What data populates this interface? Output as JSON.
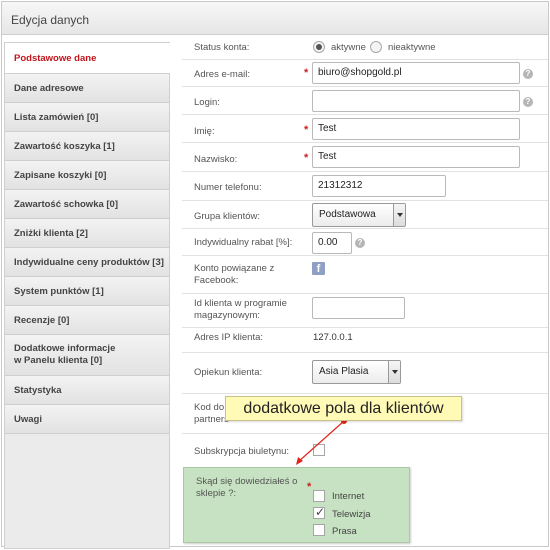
{
  "header": {
    "title": "Edycja danych"
  },
  "sidebar": {
    "items": [
      {
        "label": "Podstawowe dane",
        "active": true
      },
      {
        "label": "Dane adresowe"
      },
      {
        "label": "Lista zamówień [0]"
      },
      {
        "label": "Zawartość koszyka [1]"
      },
      {
        "label": "Zapisane koszyki [0]"
      },
      {
        "label": "Zawartość schowka [0]"
      },
      {
        "label": "Zniżki klienta [2]"
      },
      {
        "label": "Indywidualne ceny produktów [3]"
      },
      {
        "label": "System punktów [1]"
      },
      {
        "label": "Recenzje [0]"
      },
      {
        "label_line1": "Dodatkowe informacje",
        "label_line2": "w Panelu klienta [0]"
      },
      {
        "label": "Statystyka"
      },
      {
        "label": "Uwagi"
      }
    ]
  },
  "form": {
    "status": {
      "label": "Status konta:",
      "opt_active": "aktywne",
      "opt_inactive": "nieaktywne",
      "selected": "aktywne"
    },
    "email": {
      "label": "Adres e-mail:",
      "value": "biuro@shopgold.pl",
      "required_mark": "*",
      "help": "?"
    },
    "login": {
      "label": "Login:",
      "value": "",
      "help": "?"
    },
    "first_name": {
      "label": "Imię:",
      "value": "Test",
      "required_mark": "*"
    },
    "last_name": {
      "label": "Nazwisko:",
      "value": "Test",
      "required_mark": "*"
    },
    "phone": {
      "label": "Numer telefonu:",
      "value": "21312312"
    },
    "group": {
      "label": "Grupa klientów:",
      "value": "Podstawowa"
    },
    "discount": {
      "label": "Indywidualny rabat [%]:",
      "value": "0.00",
      "help": "?"
    },
    "facebook": {
      "label_line1": "Konto powiązane z",
      "label_line2": "Facebook:",
      "icon": "f"
    },
    "loyalty_id": {
      "label_line1": "Id klienta w programie",
      "label_line2": "magazynowym:",
      "value": ""
    },
    "ip": {
      "label": "Adres IP klienta:",
      "value": "127.0.0.1"
    },
    "caretaker": {
      "label": "Opiekun klienta:",
      "value": "Asia Plasia"
    },
    "partner_code": {
      "label_line1": "Kod do p",
      "label_line2": "partners"
    },
    "newsletter": {
      "label": "Subskrypcja biuletynu:",
      "checked": false
    },
    "source": {
      "label_line1": "Skąd się dowiedziałeś o",
      "label_line2": "sklepie ?:",
      "required_mark": "*",
      "options": [
        {
          "label": "Internet",
          "checked": false
        },
        {
          "label": "Telewizja",
          "checked": true
        },
        {
          "label": "Prasa",
          "checked": false
        }
      ]
    }
  },
  "callout": {
    "text": "dodatkowe pola dla klientów",
    "arrow_color": "#e0261d"
  },
  "colors": {
    "active_tab": "#c3141c",
    "required": "#cc1f1f",
    "highlight_box": "#c7e2c2",
    "callout_bg": "#fffab5"
  }
}
